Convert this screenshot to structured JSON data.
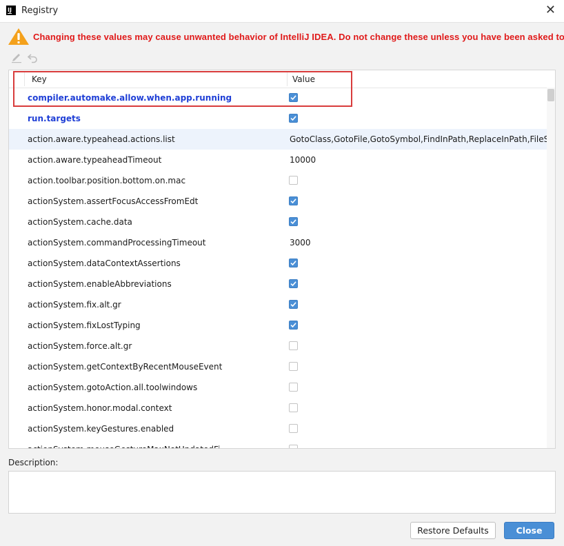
{
  "window": {
    "title": "Registry",
    "app_logo": "IJ",
    "close_symbol": "✕"
  },
  "warning": {
    "icon": "warning-triangle-icon",
    "text": "Changing these values may cause unwanted behavior of IntelliJ IDEA. Do not change these unless you have been asked to."
  },
  "toolbar": {
    "edit_icon": "pencil-icon",
    "revert_icon": "undo-icon"
  },
  "table": {
    "columns": {
      "key": "Key",
      "value": "Value"
    },
    "rows": [
      {
        "key": "compiler.automake.allow.when.app.running",
        "type": "bool",
        "checked": true,
        "modified": true
      },
      {
        "key": "run.targets",
        "type": "bool",
        "checked": true,
        "modified": true
      },
      {
        "key": "action.aware.typeahead.actions.list",
        "type": "text",
        "value": "GotoClass,GotoFile,GotoSymbol,FindInPath,ReplaceInPath,FileStru",
        "selected": true
      },
      {
        "key": "action.aware.typeaheadTimeout",
        "type": "text",
        "value": "10000"
      },
      {
        "key": "action.toolbar.position.bottom.on.mac",
        "type": "bool",
        "checked": false
      },
      {
        "key": "actionSystem.assertFocusAccessFromEdt",
        "type": "bool",
        "checked": true
      },
      {
        "key": "actionSystem.cache.data",
        "type": "bool",
        "checked": true
      },
      {
        "key": "actionSystem.commandProcessingTimeout",
        "type": "text",
        "value": "3000"
      },
      {
        "key": "actionSystem.dataContextAssertions",
        "type": "bool",
        "checked": true
      },
      {
        "key": "actionSystem.enableAbbreviations",
        "type": "bool",
        "checked": true
      },
      {
        "key": "actionSystem.fix.alt.gr",
        "type": "bool",
        "checked": true
      },
      {
        "key": "actionSystem.fixLostTyping",
        "type": "bool",
        "checked": true
      },
      {
        "key": "actionSystem.force.alt.gr",
        "type": "bool",
        "checked": false
      },
      {
        "key": "actionSystem.getContextByRecentMouseEvent",
        "type": "bool",
        "checked": false
      },
      {
        "key": "actionSystem.gotoAction.all.toolwindows",
        "type": "bool",
        "checked": false
      },
      {
        "key": "actionSystem.honor.modal.context",
        "type": "bool",
        "checked": false
      },
      {
        "key": "actionSystem.keyGestures.enabled",
        "type": "bool",
        "checked": false
      },
      {
        "key": "actionSystem.mouseGestureMaxNotUpdatedFi",
        "type": "bool",
        "checked": false
      }
    ]
  },
  "description": {
    "label": "Description:",
    "text": ""
  },
  "buttons": {
    "restore": "Restore Defaults",
    "close": "Close"
  },
  "colors": {
    "warning_red": "#e01919",
    "modified_key_blue": "#1f3fd6",
    "checkbox_blue": "#4a8fd6",
    "highlight_box": "#d83b3b",
    "selected_row": "#edf3fc"
  }
}
